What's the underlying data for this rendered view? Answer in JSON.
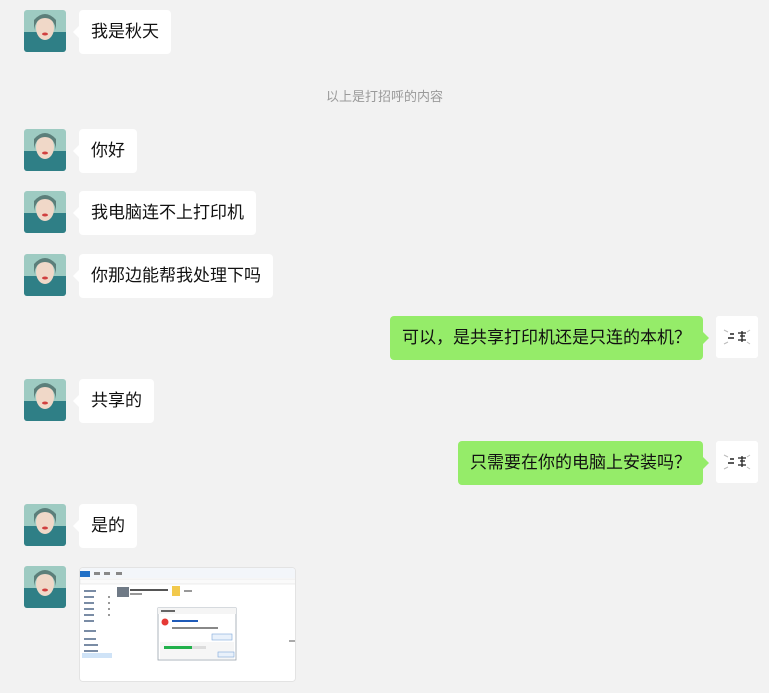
{
  "colors": {
    "background": "#f2f2f2",
    "bubble_received": "#ffffff",
    "bubble_sent": "#95ec69",
    "system_text": "#9a9a9a"
  },
  "system_notice": "以上是打招呼的内容",
  "messages": [
    {
      "side": "received",
      "text": "我是秋天"
    },
    {
      "side": "received",
      "text": "你好"
    },
    {
      "side": "received",
      "text": "我电脑连不上打印机"
    },
    {
      "side": "received",
      "text": "你那边能帮我处理下吗"
    },
    {
      "side": "sent",
      "text": "可以，是共享打印机还是只连的本机？"
    },
    {
      "side": "received",
      "text": "共享的"
    },
    {
      "side": "sent",
      "text": "只需要在你的电脑上安装吗？"
    },
    {
      "side": "received",
      "text": "是的"
    },
    {
      "side": "received",
      "type": "image",
      "text": "",
      "image_kind": "screenshot-of-windows-printer-install-dialog"
    }
  ],
  "avatars": {
    "received": "portrait-avatar-icon",
    "sent": "white-handwritten-avatar-icon"
  }
}
